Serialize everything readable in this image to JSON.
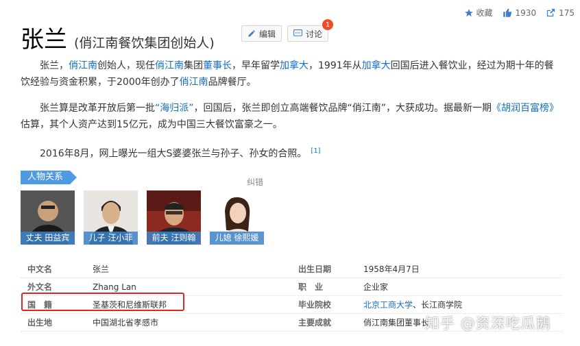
{
  "topbar": {
    "favorite_label": "收藏",
    "like_count": "1930",
    "share_count": "175"
  },
  "header": {
    "title": "张兰",
    "subtitle": "(俏江南餐饮集团创始人)",
    "edit_label": "编辑",
    "discuss_label": "讨论",
    "discuss_badge": "1"
  },
  "paragraphs": {
    "p1": {
      "t1": "张兰，",
      "l1": "俏江南",
      "t2": "创始人，现任",
      "l2": "俏江南",
      "t3": "集团",
      "l3": "董事长",
      "t4": "，早年留学",
      "l4": "加拿大",
      "t5": "，1991年从",
      "l5": "加拿大",
      "t6": "回国后进入餐饮业，经过为期十年的餐饮经验与资金积累，于2000年创办了",
      "l6": "俏江南",
      "t7": "品牌餐厅。"
    },
    "p2": {
      "t1": "张兰算是改革开放后第一批",
      "l1": "“海归派”",
      "t2": "，回国后，张兰即创立高端餐饮品牌“俏江南”，大获成功。据最新一期",
      "l2": "《胡润百富榜》",
      "t3": "估算，其个人资产达到15亿元，成为中国三大餐饮富豪之一。"
    },
    "p3": {
      "t1": "2016年8月，网上曝光一组大S婆婆张兰与孙子、孙女的合照。",
      "ref": "[1]"
    }
  },
  "relations": {
    "tag": "人物关系",
    "correct_label": "纠错",
    "people": [
      {
        "caption": "丈夫 田益宾"
      },
      {
        "caption": "儿子 汪小菲"
      },
      {
        "caption": "前夫 汪则翰"
      },
      {
        "caption": "儿媳 徐熙媛"
      }
    ]
  },
  "info": {
    "rows": [
      {
        "l1": "中文名",
        "v1": "张兰",
        "l2": "出生日期",
        "v2": "1958年4月7日"
      },
      {
        "l1": "外文名",
        "v1": "Zhang Lan",
        "l2": "职　业",
        "v2": "企业家"
      },
      {
        "l1": "国　籍",
        "v1": "圣基茨和尼维斯联邦",
        "l2": "毕业院校",
        "v2a": "北京工商大学",
        "v2b": "、长江商学院"
      },
      {
        "l1": "出生地",
        "v1": "中国湖北省孝感市",
        "l2": "主要成就",
        "v2": "俏江南集团董事长"
      }
    ]
  },
  "watermark": "知乎 @资深吃瓜鹅",
  "colors": {
    "link": "#136ec2",
    "tag_bg": "#4f9ae2",
    "highlight": "#e0261e",
    "badge": "#f04c2a"
  }
}
